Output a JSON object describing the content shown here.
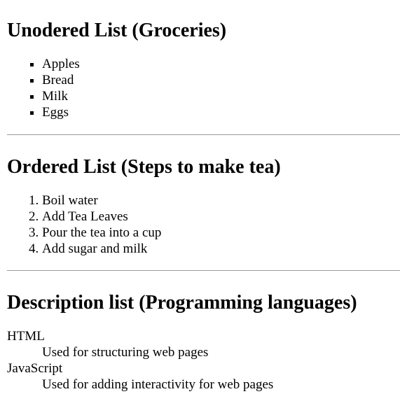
{
  "groceries": {
    "heading": "Unodered List (Groceries)",
    "items": [
      "Apples",
      "Bread",
      "Milk",
      "Eggs"
    ]
  },
  "tea": {
    "heading": "Ordered List (Steps to make tea)",
    "steps": [
      "Boil water",
      "Add Tea Leaves",
      "Pour the tea into a cup",
      "Add sugar and milk"
    ]
  },
  "languages": {
    "heading": "Description list (Programming languages)",
    "entries": [
      {
        "term": "HTML",
        "description": "Used for structuring web pages"
      },
      {
        "term": "JavaScript",
        "description": "Used for adding interactivity for web pages"
      }
    ]
  }
}
